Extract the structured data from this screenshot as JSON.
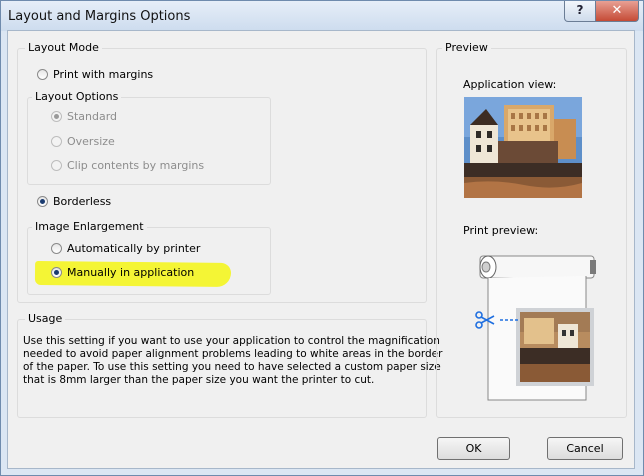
{
  "window": {
    "title": "Layout and Margins Options",
    "help_glyph": "?",
    "close_glyph": "✕"
  },
  "layout_mode": {
    "label": "Layout Mode",
    "print_with_margins": "Print with margins",
    "layout_options": {
      "label": "Layout Options",
      "standard": "Standard",
      "oversize": "Oversize",
      "clip": "Clip contents by margins"
    },
    "borderless": "Borderless",
    "image_enlargement": {
      "label": "Image Enlargement",
      "auto": "Automatically by printer",
      "manual": "Manually in application"
    }
  },
  "usage": {
    "label": "Usage",
    "text": "Use this setting if you want to use your application to control the magnification\nneeded to avoid paper alignment problems leading to white areas in the border\nof the paper. To use this setting you need to have selected a custom paper size\nthat is 8mm larger than the paper size you want the printer to cut."
  },
  "preview": {
    "label": "Preview",
    "application_view": "Application view:",
    "print_preview": "Print preview:"
  },
  "buttons": {
    "ok": "OK",
    "cancel": "Cancel"
  },
  "colors": {
    "highlight": "#f4f535",
    "scissors": "#1f6fe0"
  },
  "icons": [
    "help-icon",
    "close-icon",
    "scissors-icon"
  ]
}
